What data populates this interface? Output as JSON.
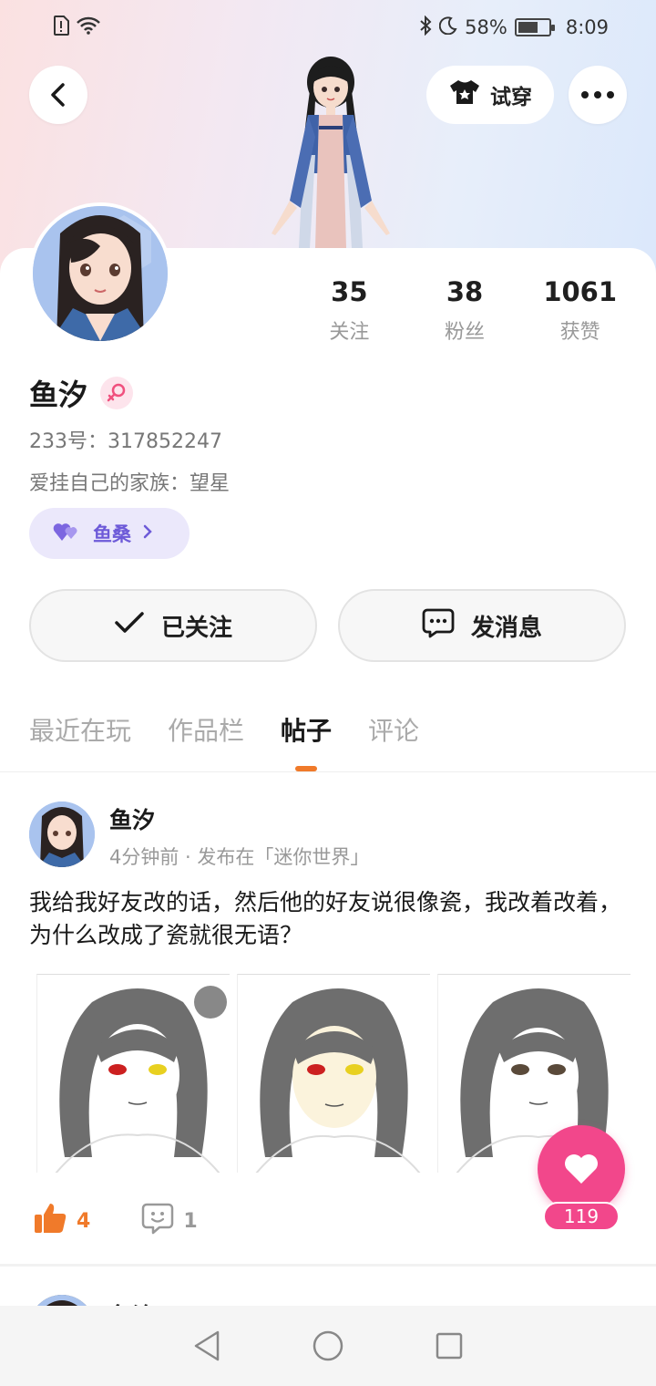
{
  "status_bar": {
    "battery": "58%",
    "time": "8:09"
  },
  "header": {
    "try_on_label": "试穿"
  },
  "profile": {
    "stats": [
      {
        "value": "35",
        "label": "关注"
      },
      {
        "value": "38",
        "label": "粉丝"
      },
      {
        "value": "1061",
        "label": "获赞"
      }
    ],
    "name": "鱼汐",
    "uid": "233号：317852247",
    "family": "爱挂自己的家族：望星",
    "tag_label": "鱼桑",
    "followed_label": "已关注",
    "message_label": "发消息"
  },
  "tabs": [
    {
      "label": "最近在玩",
      "active": false
    },
    {
      "label": "作品栏",
      "active": false
    },
    {
      "label": "帖子",
      "active": true
    },
    {
      "label": "评论",
      "active": false
    }
  ],
  "post": {
    "author": "鱼汐",
    "meta": "4分钟前 · 发布在「迷你世界」",
    "text": "我给我好友改的话，然后他的好友说很像瓷，我改着改着，为什么改成了瓷就很无语？",
    "likes": "4",
    "comments": "1"
  },
  "next_post": {
    "author": "鱼汐"
  },
  "fab": {
    "count": "119"
  },
  "colors": {
    "accent_orange": "#f07a2a",
    "accent_pink": "#f2478b",
    "tag_purple": "#6d5ad8"
  }
}
